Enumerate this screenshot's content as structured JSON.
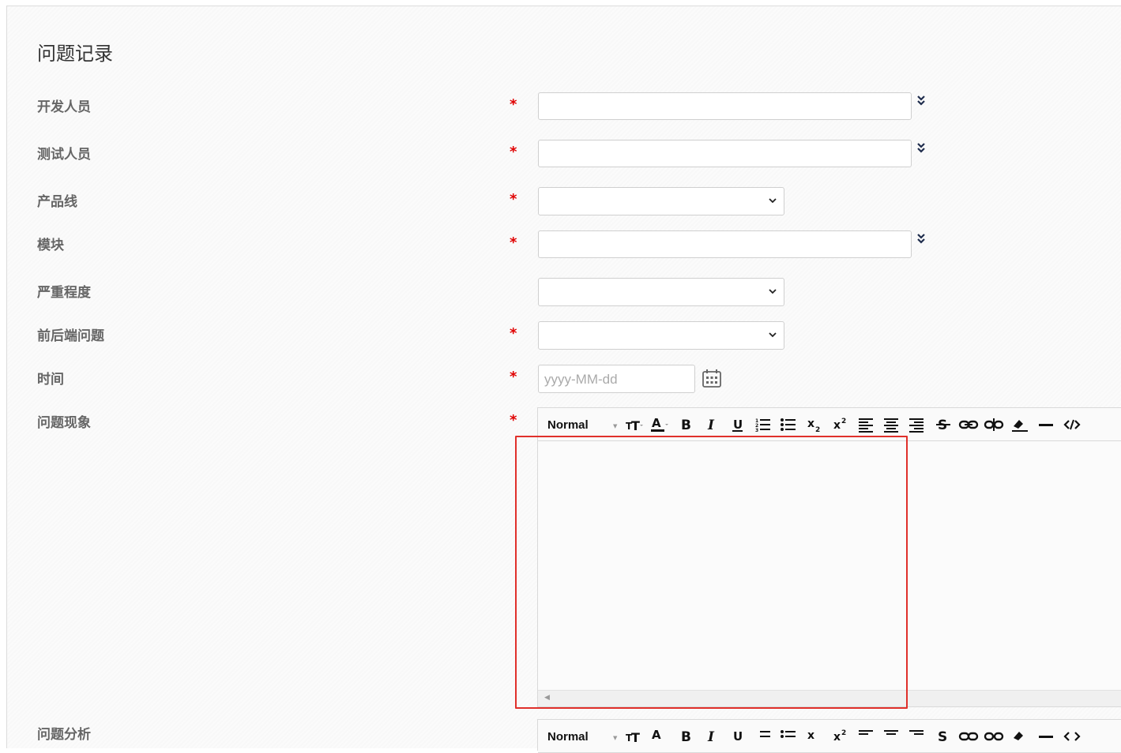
{
  "form": {
    "title": "问题记录",
    "fields": [
      {
        "label": "开发人员",
        "required_mark": "*",
        "type": "text",
        "value": ""
      },
      {
        "label": "测试人员",
        "required_mark": "*",
        "type": "text",
        "value": ""
      },
      {
        "label": "产品线",
        "required_mark": "*",
        "type": "select",
        "value": ""
      },
      {
        "label": "模块",
        "required_mark": "*",
        "type": "text",
        "value": ""
      },
      {
        "label": "严重程度",
        "required_mark": "",
        "type": "select",
        "value": ""
      },
      {
        "label": "前后端问题",
        "required_mark": "*",
        "type": "select",
        "value": ""
      },
      {
        "label": "时间",
        "required_mark": "*",
        "type": "date",
        "value": "",
        "placeholder": "yyyy-MM-dd"
      },
      {
        "label": "问题现象",
        "required_mark": "*",
        "type": "richtext",
        "value": ""
      },
      {
        "label": "问题分析",
        "required_mark": "",
        "type": "richtext",
        "value": ""
      }
    ]
  },
  "editor_toolbar": {
    "format_label": "Normal",
    "buttons": [
      "font-size-icon",
      "font-color-icon",
      "bold-icon",
      "italic-icon",
      "underline-icon",
      "ordered-list-icon",
      "unordered-list-icon",
      "subscript-icon",
      "superscript-icon",
      "align-left-icon",
      "align-center-icon",
      "align-right-icon",
      "strikethrough-icon",
      "link-icon",
      "unlink-icon",
      "clear-format-icon",
      "horizontal-rule-icon",
      "code-view-icon"
    ]
  },
  "colors": {
    "required": "#e00000",
    "highlight_box": "#e0302b"
  }
}
